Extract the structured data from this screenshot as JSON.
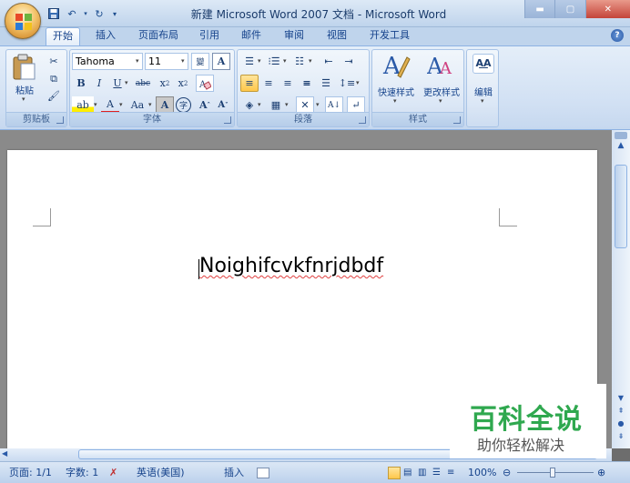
{
  "window": {
    "title": "新建 Microsoft Word 2007 文档 - Microsoft Word",
    "controls": [
      "minimize",
      "maximize",
      "close"
    ]
  },
  "quick_access": {
    "save_icon": "save-icon",
    "undo_icon": "undo-icon",
    "redo_icon": "redo-icon"
  },
  "tabs": [
    {
      "label": "开始",
      "active": true
    },
    {
      "label": "插入"
    },
    {
      "label": "页面布局"
    },
    {
      "label": "引用"
    },
    {
      "label": "邮件"
    },
    {
      "label": "审阅"
    },
    {
      "label": "视图"
    },
    {
      "label": "开发工具"
    }
  ],
  "ribbon": {
    "clipboard": {
      "label": "剪贴板",
      "paste": "粘贴"
    },
    "font": {
      "label": "字体",
      "font_name": "Tahoma",
      "font_size": "11"
    },
    "paragraph": {
      "label": "段落"
    },
    "styles": {
      "label": "样式",
      "quick_styles": "快速样式",
      "change_styles": "更改样式"
    },
    "editing": {
      "label": "编辑"
    }
  },
  "document": {
    "text": "Noighifcvkfnrjdbdf"
  },
  "status": {
    "page": "页面: 1/1",
    "words": "字数: 1",
    "language": "英语(美国)",
    "mode": "插入",
    "zoom": "100%"
  },
  "watermark": {
    "title": "百科全说",
    "subtitle": "助你轻松解决"
  },
  "colors": {
    "accent": "#15428b",
    "ribbon_bg": "#dbe7f5",
    "highlight": "#ffc74a",
    "font_color": "#e02020",
    "watermark_green": "#2fa84f"
  }
}
